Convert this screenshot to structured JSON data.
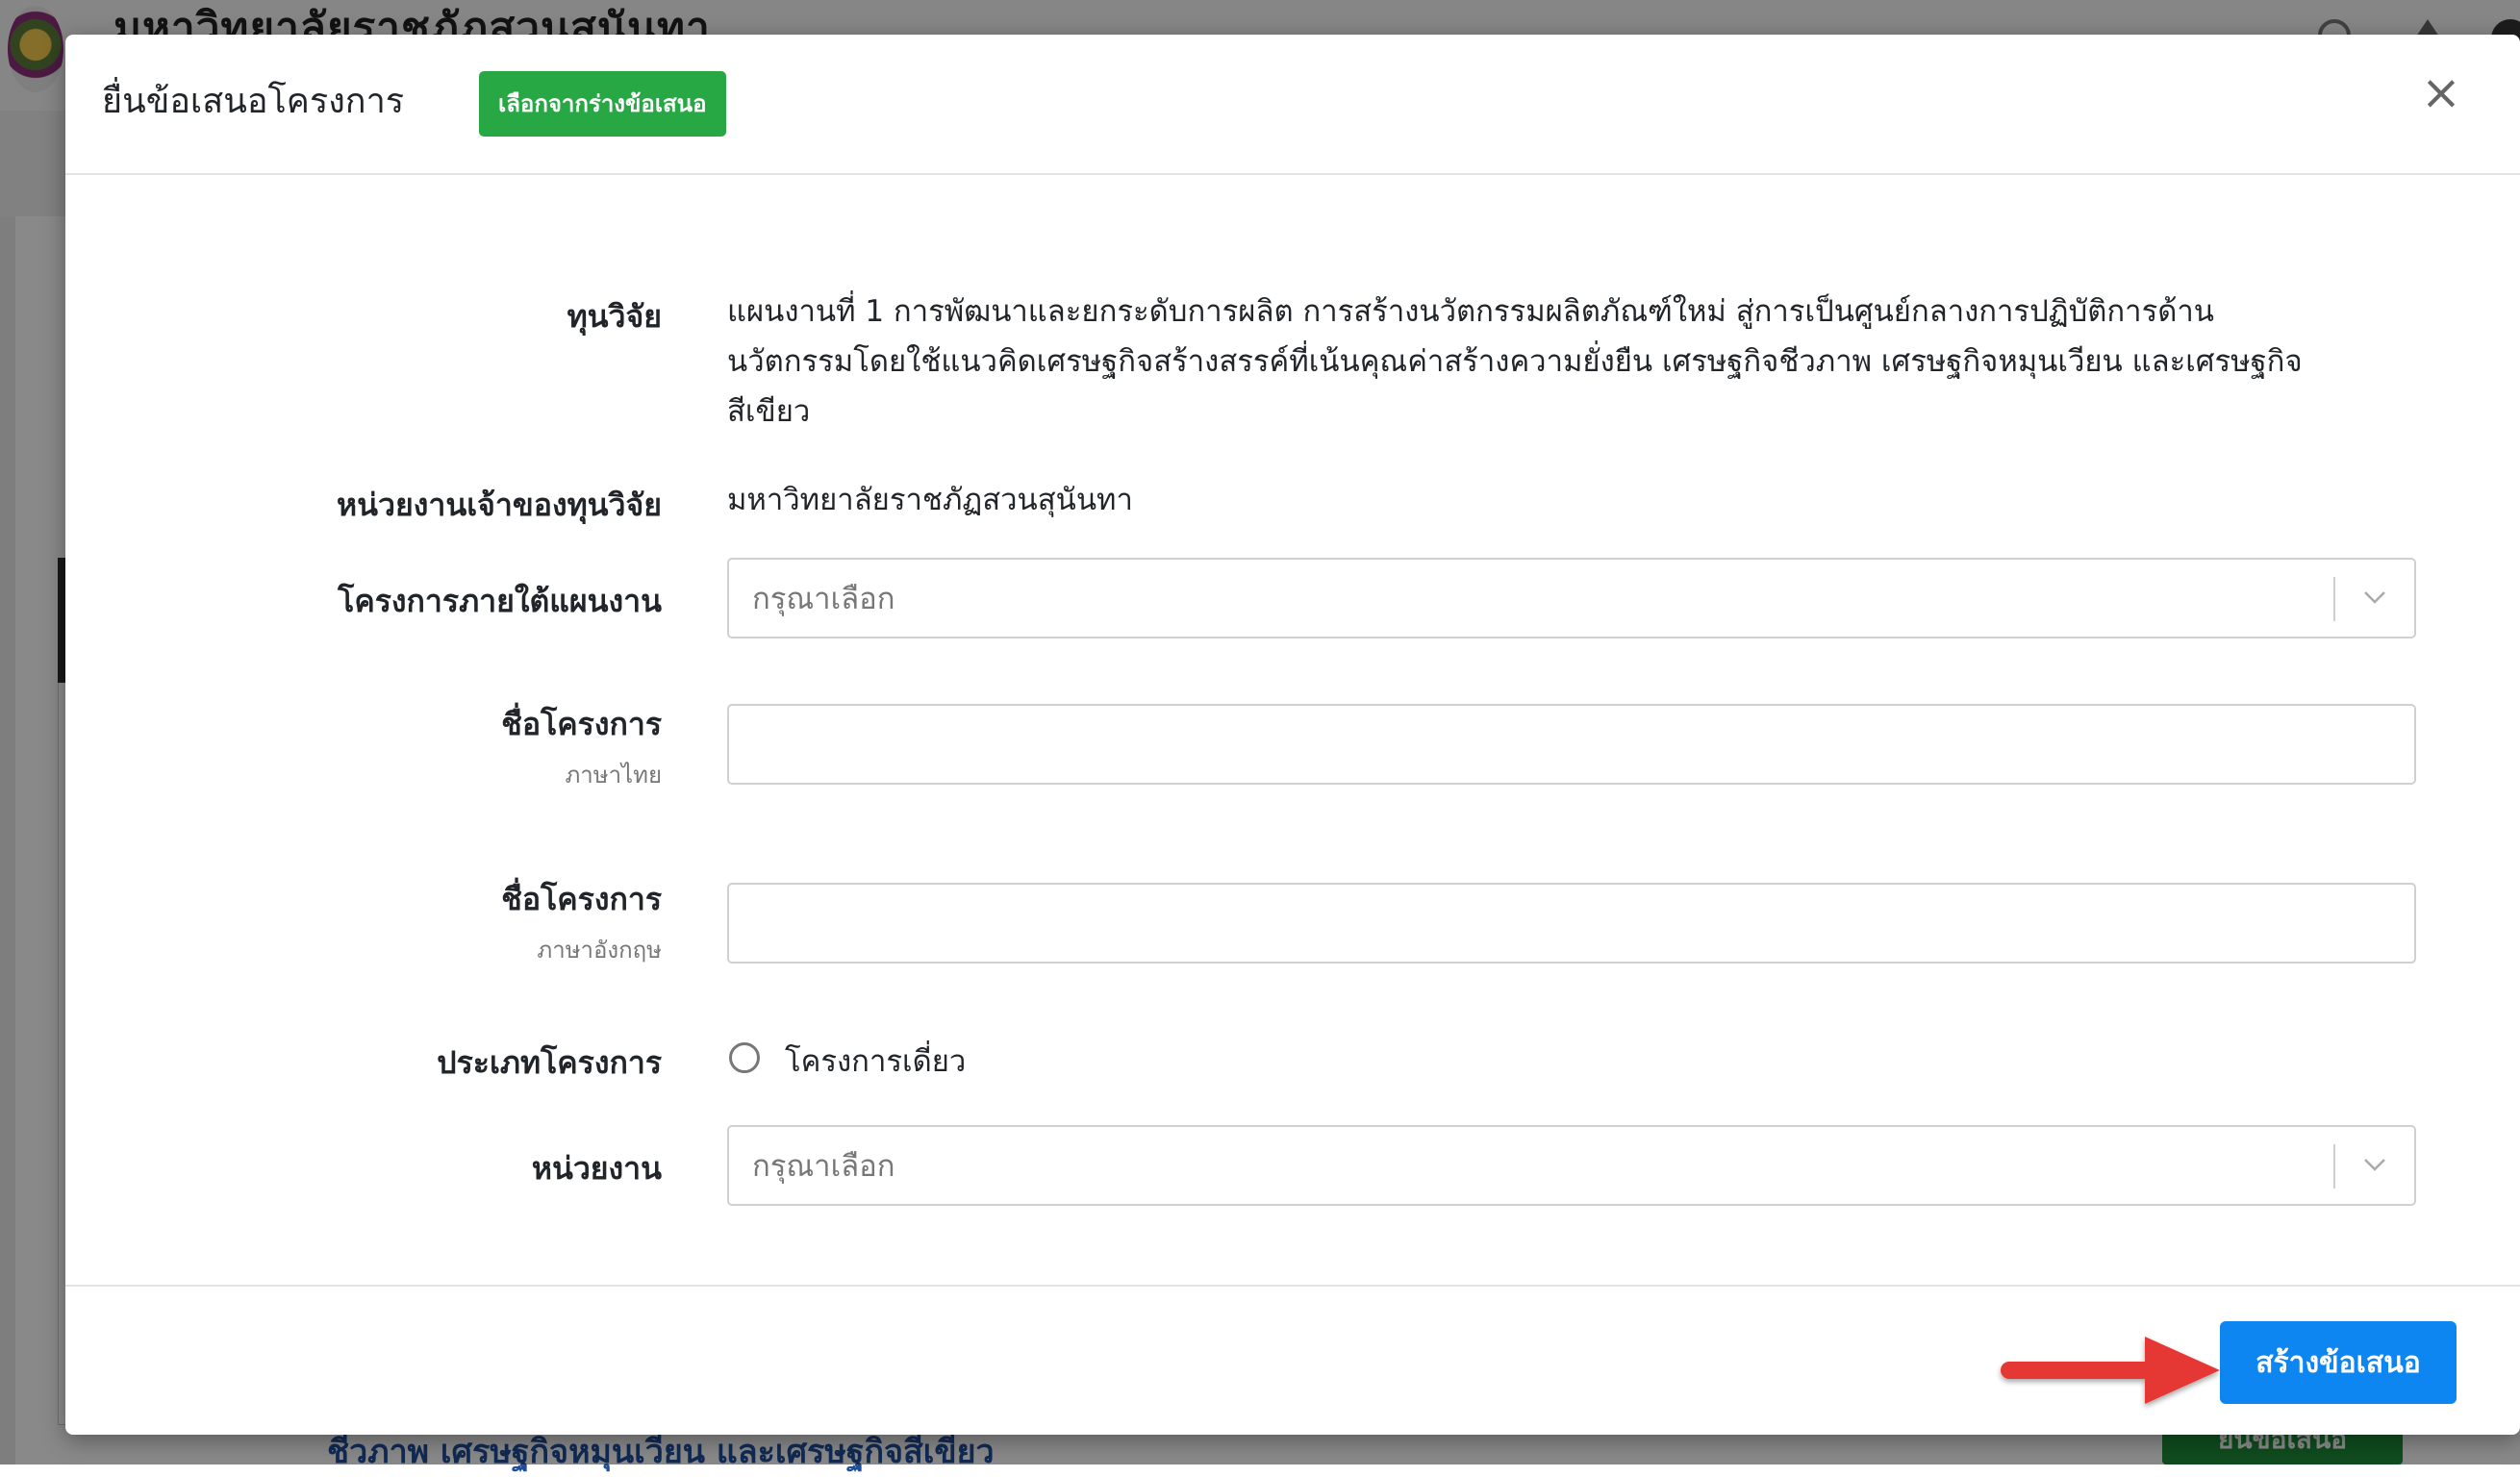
{
  "background": {
    "site_title": "มหาวิทยาลัยราชภัฏสวนสุนันทา",
    "bottom_text": "ชีวภาพ เศรษฐกิจหมุนเวียน และเศรษฐกิจสีเขียว",
    "bottom_button": "ยื่นข้อเสนอ"
  },
  "modal": {
    "title": "ยื่นข้อเสนอโครงการ",
    "draft_button": "เลือกจากร่างข้อเสนอ",
    "close_symbol": "×",
    "fund": {
      "label": "ทุนวิจัย",
      "value_lines": [
        "แผนงานที่ 1 การพัฒนาและยกระดับการผลิต การสร้างนวัตกรรมผลิตภัณฑ์ใหม่ สู่การเป็นศูนย์กลางการปฏิบัติการด้าน",
        "นวัตกรรมโดยใช้แนวคิดเศรษฐกิจสร้างสรรค์ที่เน้นคุณค่าสร้างความยั่งยืน เศรษฐกิจชีวภาพ เศรษฐกิจหมุนเวียน และเศรษฐกิจ",
        "สีเขียว"
      ]
    },
    "owner": {
      "label": "หน่วยงานเจ้าของทุนวิจัย",
      "value": "มหาวิทยาลัยราชภัฏสวนสุนันทา"
    },
    "project_under_plan": {
      "label": "โครงการภายใต้แผนงาน",
      "placeholder": "กรุณาเลือก"
    },
    "name_th": {
      "label": "ชื่อโครงการ",
      "sublabel": "ภาษาไทย",
      "value": ""
    },
    "name_en": {
      "label": "ชื่อโครงการ",
      "sublabel": "ภาษาอังกฤษ",
      "value": ""
    },
    "project_type": {
      "label": "ประเภทโครงการ",
      "option": "โครงการเดี่ยว"
    },
    "department": {
      "label": "หน่วยงาน",
      "placeholder": "กรุณาเลือก"
    },
    "create_button": "สร้างข้อเสนอ"
  },
  "colors": {
    "primary": "#0d86f2",
    "success": "#28a745",
    "arrow": "#e53935"
  },
  "icons": {
    "close": "close-icon",
    "chevron": "chevron-down-icon",
    "arrow": "arrow-right-icon"
  }
}
